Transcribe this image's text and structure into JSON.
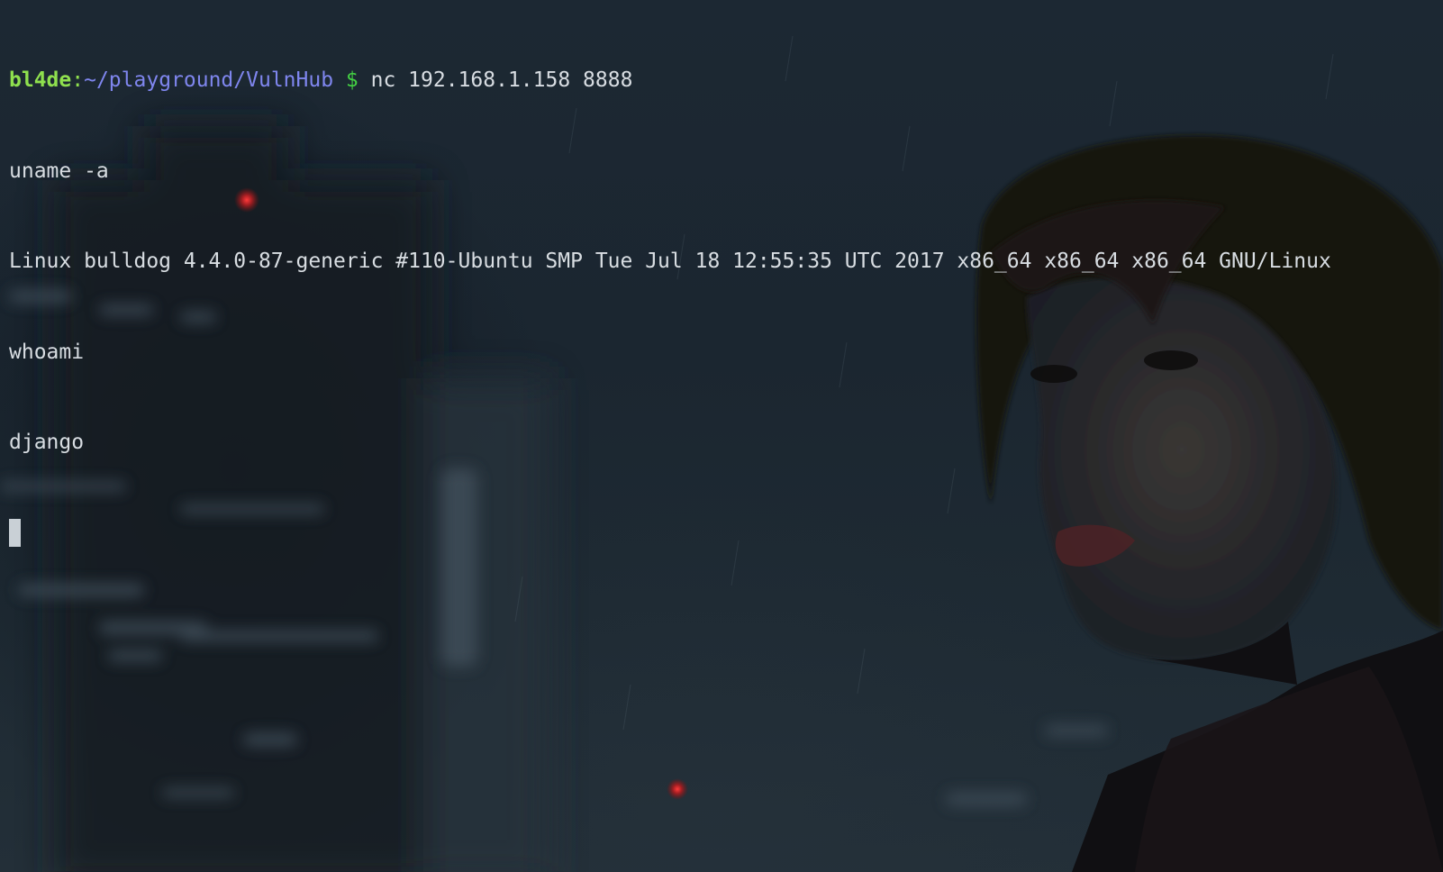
{
  "terminal": {
    "prompt": {
      "user_host": "bl4de",
      "separator": ":",
      "path": "~/playground/VulnHub",
      "symbol": "$",
      "command": "nc 192.168.1.158 8888"
    },
    "lines": [
      "uname -a",
      "Linux bulldog 4.4.0-87-generic #110-Ubuntu SMP Tue Jul 18 12:55:35 UTC 2017 x86_64 x86_64 x86_64 GNU/Linux",
      "whoami",
      "django"
    ],
    "colors": {
      "user": "#8fe04e",
      "path": "#7f86ee",
      "dollar": "#43d043",
      "text": "#d8dde2",
      "background": "#1b2630"
    }
  }
}
